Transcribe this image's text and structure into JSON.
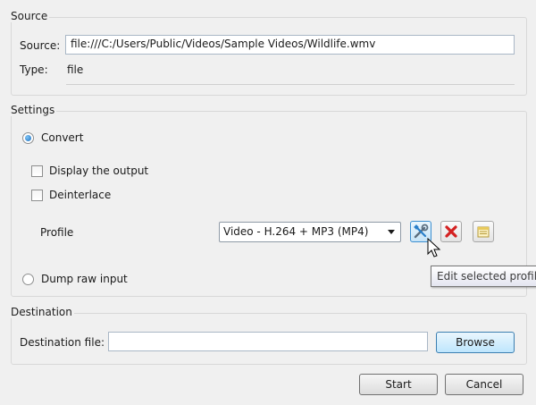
{
  "source": {
    "group_title": "Source",
    "source_label": "Source:",
    "source_value": "file:///C:/Users/Public/Videos/Sample Videos/Wildlife.wmv",
    "type_label": "Type:",
    "type_value": "file"
  },
  "settings": {
    "group_title": "Settings",
    "convert_label": "Convert",
    "convert_selected": true,
    "display_output_label": "Display the output",
    "deinterlace_label": "Deinterlace",
    "profile_label": "Profile",
    "profile_value": "Video - H.264 + MP3 (MP4)",
    "dump_raw_label": "Dump raw input",
    "profile_buttons": [
      {
        "name": "edit-profile-button",
        "icon": "tools-icon"
      },
      {
        "name": "delete-profile-button",
        "icon": "red-x-icon"
      },
      {
        "name": "new-profile-button",
        "icon": "new-profile-icon"
      }
    ]
  },
  "destination": {
    "group_title": "Destination",
    "file_label": "Destination file:",
    "file_value": "",
    "browse_label": "Browse"
  },
  "actions": {
    "start_label": "Start",
    "cancel_label": "Cancel"
  },
  "tooltip": {
    "text": "Edit selected profile"
  },
  "colors": {
    "accent_blue": "#3c8fd0",
    "delete_red": "#d42020"
  }
}
